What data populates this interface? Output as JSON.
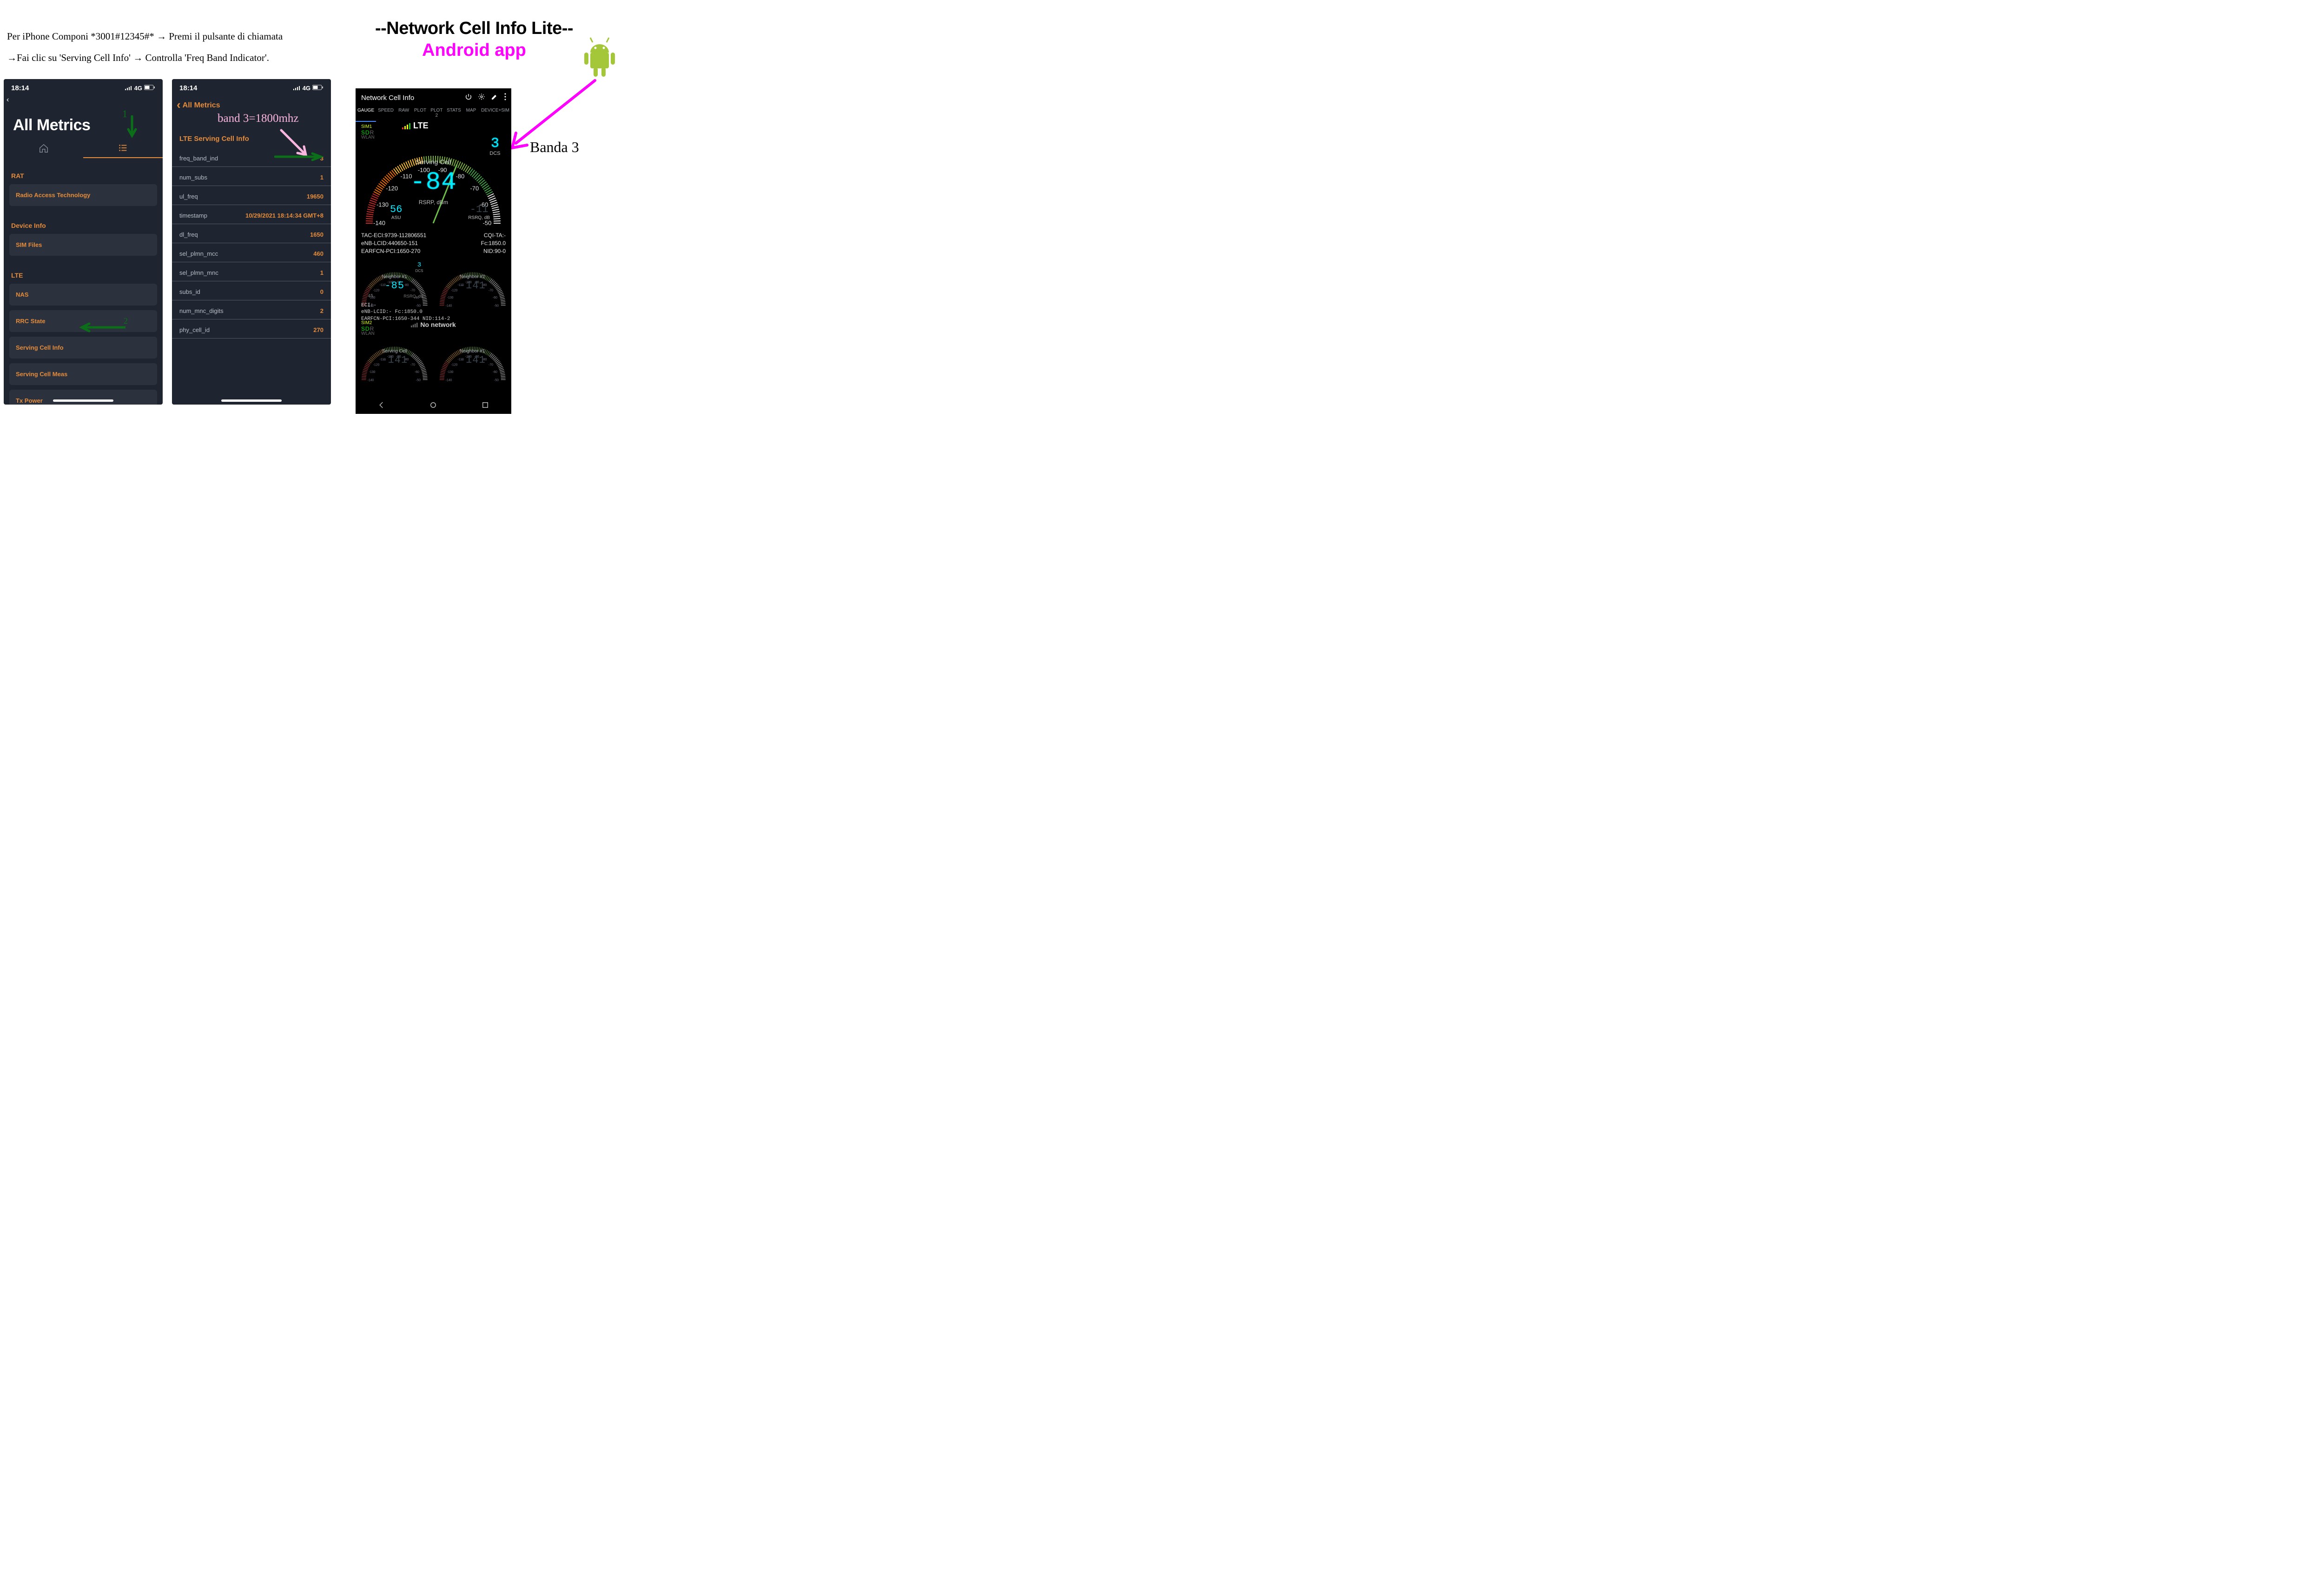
{
  "instructions": {
    "line1": "Per iPhone Componi *3001#12345#* → Premi il pulsante di chiamata",
    "line2": "→Fai clic su 'Serving Cell Info' → Controlla 'Freq Band Indicator'."
  },
  "screen1": {
    "time": "18:14",
    "net": "4G",
    "title": "All Metrics",
    "annot1_num": "1",
    "annot2_num": "2",
    "sections": [
      {
        "label": "RAT",
        "items": [
          "Radio Access Technology"
        ]
      },
      {
        "label": "Device Info",
        "items": [
          "SIM Files"
        ]
      },
      {
        "label": "LTE",
        "items": [
          "NAS",
          "RRC State",
          "Serving Cell Info",
          "Serving Cell Meas",
          "Tx Power"
        ]
      }
    ]
  },
  "screen2": {
    "time": "18:14",
    "net": "4G",
    "back": "All Metrics",
    "subtitle": "LTE Serving Cell Info",
    "annot_band": "band 3=1800mhz",
    "rows": [
      {
        "k": "freq_band_ind",
        "v": "3"
      },
      {
        "k": "num_subs",
        "v": "1"
      },
      {
        "k": "ul_freq",
        "v": "19650"
      },
      {
        "k": "timestamp",
        "v": "10/29/2021 18:14:34 GMT+8"
      },
      {
        "k": "dl_freq",
        "v": "1650"
      },
      {
        "k": "sel_plmn_mcc",
        "v": "460"
      },
      {
        "k": "sel_plmn_mnc",
        "v": "1"
      },
      {
        "k": "subs_id",
        "v": "0"
      },
      {
        "k": "num_mnc_digits",
        "v": "2"
      },
      {
        "k": "phy_cell_id",
        "v": "270"
      }
    ]
  },
  "right": {
    "title1": "--Network Cell Info Lite--",
    "title2": "Android app",
    "banda_label": "Banda 3"
  },
  "android": {
    "header": "Network Cell Info",
    "tabs": [
      "GAUGE",
      "SPEED",
      "RAW",
      "PLOT",
      "PLOT 2",
      "STATS",
      "MAP",
      "DEVICE+SIM"
    ],
    "sim1_label": "SIM1",
    "sd_label": "SD",
    "r_label": "R",
    "wlan_label": "WLAN",
    "rat": "LTE",
    "dcs_val": "3",
    "dcs_label": "DCS",
    "gauge_ticks": [
      "-140",
      "-130",
      "-120",
      "-110",
      "-100",
      "-90",
      "-80",
      "-70",
      "-60",
      "-50"
    ],
    "serving_cell": "Serving Cell",
    "rsrp_val": "-84",
    "rsrp_label": "RSRP, dBm",
    "asu_val": "56",
    "asu_label": "ASU",
    "rsrq_val": "-11",
    "rsrq_label": "RSRQ, dB",
    "params": [
      {
        "l": "TAC-ECI:9739-112806551",
        "r": "CQI-TA:-"
      },
      {
        "l": "eNB-LCID:440650-151",
        "r": "Fc:1850.0"
      },
      {
        "l": "EARFCN-PCI:1650-270",
        "r": "NID:90-0"
      }
    ],
    "mini1": {
      "title": "Neighbor #1",
      "val": "-85",
      "asu": "45",
      "rsrp_lbl": "RSRP, dBm",
      "rsrq_lbl": "RSRQ, dB",
      "dcs": "3"
    },
    "mini2": {
      "title": "Neighbor #2",
      "val": "-141",
      "ticks": "-140"
    },
    "params2": [
      "ECI:-",
      "eNB-LCID:-             Fc:1850.0",
      "EARFCN-PCI:1650-344    NID:114-2"
    ],
    "sim2_label": "SIM2",
    "no_network": "No network",
    "mini3": {
      "title": "Serving Cell",
      "val": "-141"
    },
    "mini4": {
      "title": "Neighbor #1",
      "val": "-141"
    }
  }
}
